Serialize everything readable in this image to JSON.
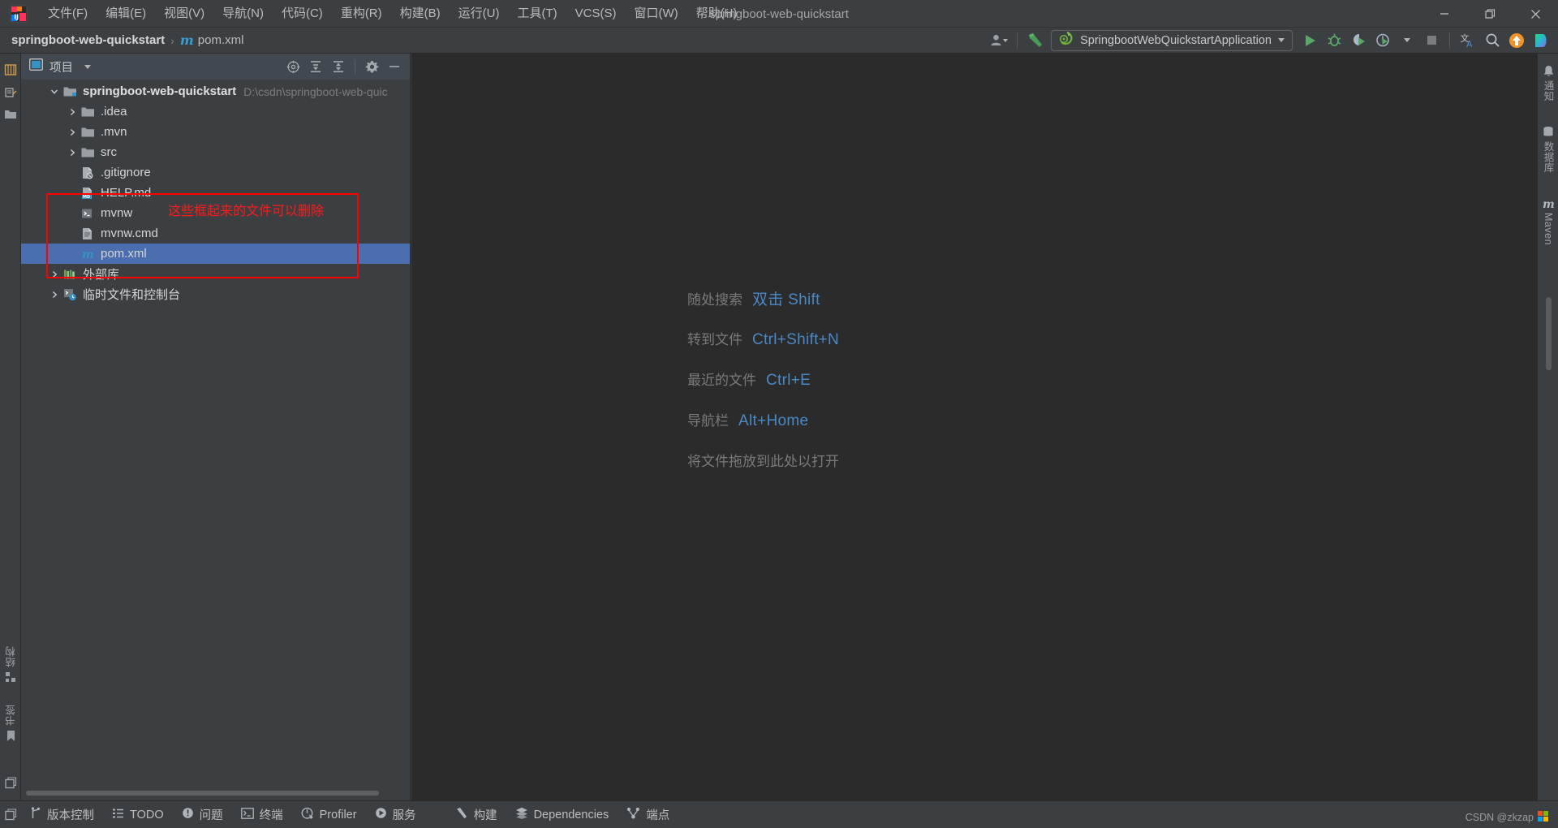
{
  "window": {
    "title": "springboot-web-quickstart",
    "controls": {
      "minimize": "minimize-icon",
      "maximize": "restore-icon",
      "close": "close-icon"
    }
  },
  "menubar": {
    "logo": "intellij-idea-logo",
    "items": [
      {
        "label": "文件(F)",
        "text": "文件",
        "mnemonic": "F"
      },
      {
        "label": "编辑(E)",
        "text": "编辑",
        "mnemonic": "E"
      },
      {
        "label": "视图(V)",
        "text": "视图",
        "mnemonic": "V"
      },
      {
        "label": "导航(N)",
        "text": "导航",
        "mnemonic": "N"
      },
      {
        "label": "代码(C)",
        "text": "代码",
        "mnemonic": "C"
      },
      {
        "label": "重构(R)",
        "text": "重构",
        "mnemonic": "R"
      },
      {
        "label": "构建(B)",
        "text": "构建",
        "mnemonic": "B"
      },
      {
        "label": "运行(U)",
        "text": "运行",
        "mnemonic": "U"
      },
      {
        "label": "工具(T)",
        "text": "工具",
        "mnemonic": "T"
      },
      {
        "label": "VCS(S)",
        "text": "VCS",
        "mnemonic": "S"
      },
      {
        "label": "窗口(W)",
        "text": "窗口",
        "mnemonic": "W"
      },
      {
        "label": "帮助(H)",
        "text": "帮助",
        "mnemonic": "H"
      }
    ]
  },
  "toolbar": {
    "breadcrumb": {
      "project": "springboot-web-quickstart",
      "separator": "›",
      "file_badge": "m",
      "file": "pom.xml"
    },
    "run_configuration": {
      "name": "SpringbootWebQuickstartApplication",
      "icon": "spring-boot-icon",
      "dropdown": "chevron-down-icon"
    },
    "right_icons": [
      {
        "name": "user-account-icon",
        "label": ""
      },
      {
        "name": "build-hammer-icon",
        "label": ""
      },
      {
        "name": "run-icon",
        "label": ""
      },
      {
        "name": "debug-icon",
        "label": ""
      },
      {
        "name": "run-with-coverage-icon",
        "label": ""
      },
      {
        "name": "profiler-icon",
        "label": ""
      },
      {
        "name": "stop-icon",
        "label": ""
      },
      {
        "name": "translate-icon",
        "label": ""
      },
      {
        "name": "search-everywhere-icon",
        "label": ""
      },
      {
        "name": "update-project-icon",
        "label": ""
      },
      {
        "name": "ide-assistant-icon",
        "label": ""
      }
    ]
  },
  "project_panel": {
    "header": {
      "icon": "project-view-icon",
      "title": "项目",
      "dropdown": "chevron-down-icon",
      "actions": [
        {
          "name": "scroll-from-source-icon"
        },
        {
          "name": "expand-all-icon"
        },
        {
          "name": "collapse-all-icon"
        },
        {
          "name": "settings-gear-icon"
        },
        {
          "name": "hide-panel-icon"
        }
      ]
    },
    "tree": [
      {
        "label": "springboot-web-quickstart",
        "path": "D:\\csdn\\springboot-web-quic",
        "icon": "module-folder-icon",
        "arrow": "expanded",
        "indent": 0,
        "bold": true,
        "selected": false
      },
      {
        "label": ".idea",
        "path": "",
        "icon": "folder-icon",
        "arrow": "collapsed",
        "indent": 1,
        "bold": false,
        "selected": false
      },
      {
        "label": ".mvn",
        "path": "",
        "icon": "folder-icon",
        "arrow": "collapsed",
        "indent": 1,
        "bold": false,
        "selected": false
      },
      {
        "label": "src",
        "path": "",
        "icon": "folder-icon",
        "arrow": "collapsed",
        "indent": 1,
        "bold": false,
        "selected": false
      },
      {
        "label": ".gitignore",
        "path": "",
        "icon": "gitignore-file-icon",
        "arrow": "none",
        "indent": 1,
        "bold": false,
        "selected": false
      },
      {
        "label": "HELP.md",
        "path": "",
        "icon": "markdown-file-icon",
        "arrow": "none",
        "indent": 1,
        "bold": false,
        "selected": false
      },
      {
        "label": "mvnw",
        "path": "",
        "icon": "shell-script-icon",
        "arrow": "none",
        "indent": 1,
        "bold": false,
        "selected": false
      },
      {
        "label": "mvnw.cmd",
        "path": "",
        "icon": "cmd-file-icon",
        "arrow": "none",
        "indent": 1,
        "bold": false,
        "selected": false
      },
      {
        "label": "pom.xml",
        "path": "",
        "icon": "maven-pom-icon",
        "arrow": "none",
        "indent": 1,
        "bold": false,
        "selected": true
      },
      {
        "label": "外部库",
        "path": "",
        "icon": "external-libraries-icon",
        "arrow": "collapsed",
        "indent": 0,
        "bold": false,
        "selected": false
      },
      {
        "label": "临时文件和控制台",
        "path": "",
        "icon": "scratches-consoles-icon",
        "arrow": "collapsed",
        "indent": 0,
        "bold": false,
        "selected": false
      }
    ],
    "annotation": {
      "text": "这些框起来的文件可以删除",
      "color": "#ff0000"
    }
  },
  "editor": {
    "hints": [
      {
        "label": "随处搜索",
        "key": "双击 Shift"
      },
      {
        "label": "转到文件",
        "key": "Ctrl+Shift+N"
      },
      {
        "label": "最近的文件",
        "key": "Ctrl+E"
      },
      {
        "label": "导航栏",
        "key": "Alt+Home"
      },
      {
        "label": "将文件拖放到此处以打开",
        "key": ""
      }
    ]
  },
  "rail_left": {
    "top": [
      {
        "name": "project-tool-icon",
        "label": "项目"
      },
      {
        "name": "commit-tool-icon",
        "label": ""
      }
    ],
    "bottom": [
      {
        "name": "structure-tool-icon",
        "label": "结构"
      },
      {
        "name": "bookmarks-tool-icon",
        "label": "书签"
      }
    ],
    "footer": {
      "name": "layout-toggle-icon",
      "label": ""
    }
  },
  "rail_right": {
    "items": [
      {
        "name": "notifications-tool-icon",
        "label": "通知"
      },
      {
        "name": "database-tool-icon",
        "label": "数据库"
      },
      {
        "name": "maven-tool-icon",
        "label": "Maven"
      }
    ]
  },
  "statusbar": {
    "items": [
      {
        "label": "版本控制",
        "icon": "vcs-branch-icon"
      },
      {
        "label": "TODO",
        "icon": "todo-list-icon"
      },
      {
        "label": "问题",
        "icon": "problems-icon"
      },
      {
        "label": "终端",
        "icon": "terminal-icon"
      },
      {
        "label": "Profiler",
        "icon": "profiler-icon"
      },
      {
        "label": "服务",
        "icon": "services-icon"
      },
      {
        "label": "构建",
        "icon": "build-hammer-icon"
      },
      {
        "label": "Dependencies",
        "icon": "dependencies-icon"
      },
      {
        "label": "端点",
        "icon": "endpoints-icon"
      }
    ],
    "watermark": "CSDN @zkzap"
  },
  "colors": {
    "accent_blue": "#4a88c7",
    "selection_blue": "#4b6eaf",
    "annotation_red": "#ff0000",
    "panel_bg": "#3c3f41",
    "editor_bg": "#2b2b2b",
    "header_bg": "#41484f"
  }
}
